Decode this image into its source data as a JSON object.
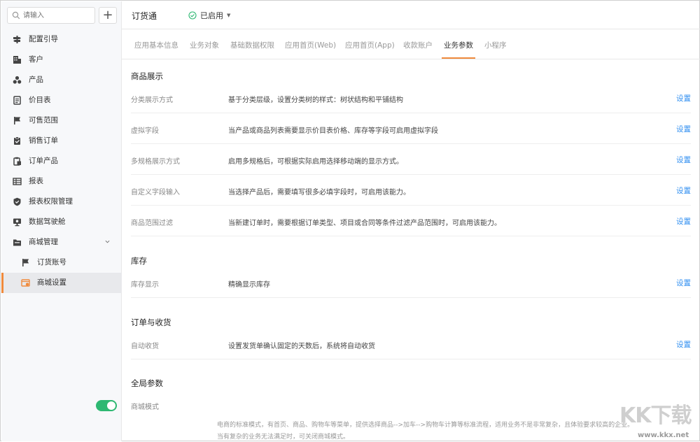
{
  "search": {
    "placeholder": "请输入",
    "add_label": "+"
  },
  "sidebar": {
    "items": [
      {
        "label": "配置引导",
        "icon": "signpost-icon"
      },
      {
        "label": "客户",
        "icon": "building-icon"
      },
      {
        "label": "产品",
        "icon": "cubes-icon"
      },
      {
        "label": "价目表",
        "icon": "list-icon"
      },
      {
        "label": "可售范围",
        "icon": "flag-icon"
      },
      {
        "label": "销售订单",
        "icon": "clipboard-check-icon"
      },
      {
        "label": "订单产品",
        "icon": "order-product-icon"
      },
      {
        "label": "报表",
        "icon": "table-icon"
      },
      {
        "label": "报表权限管理",
        "icon": "shield-icon"
      },
      {
        "label": "数据驾驶舱",
        "icon": "monitor-icon"
      },
      {
        "label": "商城管理",
        "icon": "folder-icon",
        "expanded": true
      },
      {
        "label": "订货账号",
        "icon": "flag-icon",
        "sub": true
      },
      {
        "label": "商城设置",
        "icon": "store-settings-icon",
        "sub": true,
        "active": true
      }
    ]
  },
  "header": {
    "title": "订货通",
    "status": "已启用",
    "status_color": "#2eb872"
  },
  "tabs": [
    {
      "label": "应用基本信息"
    },
    {
      "label": "业务对象"
    },
    {
      "label": "基础数据权限"
    },
    {
      "label": "应用首页(Web)"
    },
    {
      "label": "应用首页(App)"
    },
    {
      "label": "收款账户"
    },
    {
      "label": "业务参数",
      "active": true
    },
    {
      "label": "小程序"
    }
  ],
  "sections": {
    "product": {
      "title": "商品展示",
      "rows": [
        {
          "key": "分类展示方式",
          "value": "基于分类层级，设置分类树的样式：树状结构和平铺结构",
          "action": "设置"
        },
        {
          "key": "虚拟字段",
          "value": "当产品或商品列表需要显示价目表价格、库存等字段可启用虚拟字段",
          "action": "设置"
        },
        {
          "key": "多规格展示方式",
          "value": "启用多规格后，可根据实际启用选择移动端的显示方式。",
          "action": "设置"
        },
        {
          "key": "自定义字段输入",
          "value": "当选择产品后，需要填写很多必填字段时，可启用该能力。",
          "action": "设置"
        },
        {
          "key": "商品范围过滤",
          "value": "当新建订单时，需要根据订单类型、项目或合同等条件过滤产品范围时，可启用该能力。",
          "action": "设置"
        }
      ]
    },
    "inventory": {
      "title": "库存",
      "rows": [
        {
          "key": "库存显示",
          "value": "精确显示库存",
          "action": "设置"
        }
      ]
    },
    "order": {
      "title": "订单与收货",
      "rows": [
        {
          "key": "自动收货",
          "value": "设置发货单确认固定的天数后，系统将自动收货",
          "action": "设置"
        }
      ]
    },
    "global": {
      "title": "全局参数",
      "mall_mode_label": "商城模式",
      "mall_mode_on": true,
      "desc1": "电商的标准模式，有首页、商品、购物车等菜单，提供选择商品-->加车-->购物车计算等标准流程，适用业务不是非常复杂，且体验要求较高的企业。",
      "desc2": "当有复杂的业务无法满足时，可关闭商城模式。"
    }
  },
  "watermark": {
    "text": "KK下载",
    "url": "www.kkx.net"
  },
  "colors": {
    "accent": "#f08a3c",
    "link": "#2f8ef0",
    "toggle_on": "#2eb872"
  }
}
